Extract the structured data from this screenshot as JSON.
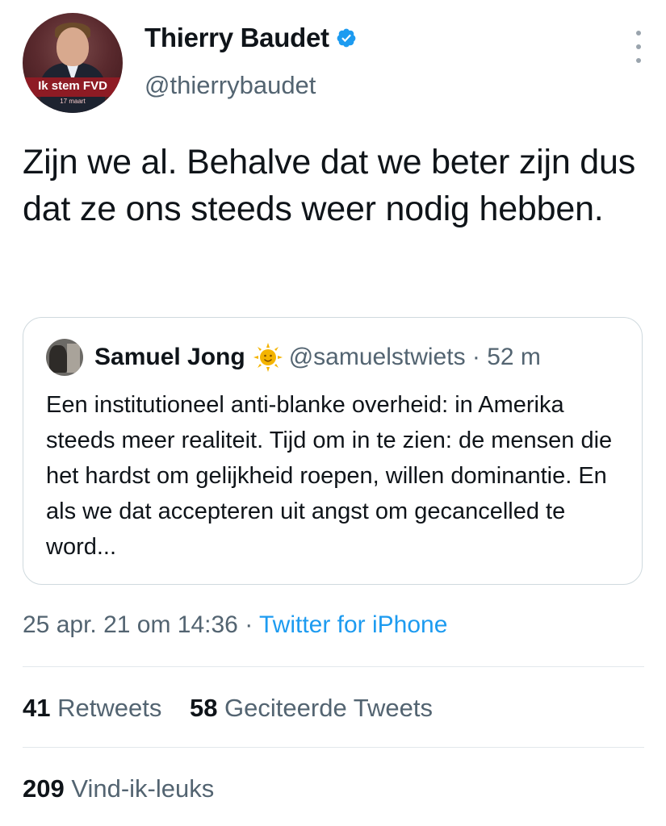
{
  "author": {
    "name": "Thierry Baudet",
    "handle": "@thierrybaudet",
    "avatar_banner": "Ik stem FVD",
    "avatar_subbanner": "17 maart",
    "verified_icon": "verified-badge-icon"
  },
  "tweet": {
    "text": "Zijn we al. Behalve dat we beter zijn dus dat ze ons steeds weer nodig hebben."
  },
  "quoted_tweet": {
    "name": "Samuel Jong",
    "emoji_icon": "sun-emoji-icon",
    "handle_time": "@samuelstwiets · 52 m",
    "text": "Een institutioneel anti-blanke overheid: in Amerika steeds meer realiteit. Tijd om in te zien: de mensen die het hardst om gelijkheid roepen, willen dominantie. En als we dat accepteren uit angst om gecancelled te word..."
  },
  "meta": {
    "timestamp": "25 apr. 21 om 14:36 · ",
    "source": "Twitter for iPhone"
  },
  "stats": {
    "retweets_count": "41",
    "retweets_label": " Retweets",
    "quotes_count": "58",
    "quotes_label": " Geciteerde Tweets",
    "likes_count": "209",
    "likes_label": " Vind-ik-leuks"
  },
  "colors": {
    "accent": "#1d9bf0",
    "secondary_text": "#536471",
    "border": "#cfd9de"
  }
}
